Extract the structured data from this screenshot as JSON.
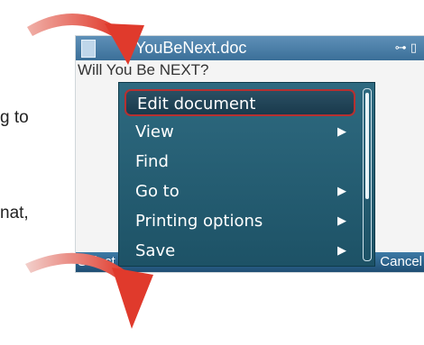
{
  "background_text": [
    "g to",
    "nat,"
  ],
  "window": {
    "title": "YouBeNext.doc",
    "document_heading": "Will You Be NEXT?"
  },
  "menu": {
    "items": [
      {
        "label": "Edit document",
        "selected": true,
        "has_submenu": false
      },
      {
        "label": "View",
        "selected": false,
        "has_submenu": true
      },
      {
        "label": "Find",
        "selected": false,
        "has_submenu": false
      },
      {
        "label": "Go to",
        "selected": false,
        "has_submenu": true
      },
      {
        "label": "Printing options",
        "selected": false,
        "has_submenu": true
      },
      {
        "label": "Save",
        "selected": false,
        "has_submenu": true
      }
    ],
    "scroll_fraction": 0.6
  },
  "softkeys": {
    "left": "Select",
    "right": "Cancel"
  },
  "colors": {
    "menu_bg": "#255f74",
    "highlight_border": "#b73030",
    "titlebar": "#4a7ea8",
    "arrow": "#e03a2c"
  },
  "icons": {
    "doc": "document-icon",
    "signal": "signal-icon",
    "battery": "battery-icon",
    "chevron": "chevron-right-icon"
  }
}
